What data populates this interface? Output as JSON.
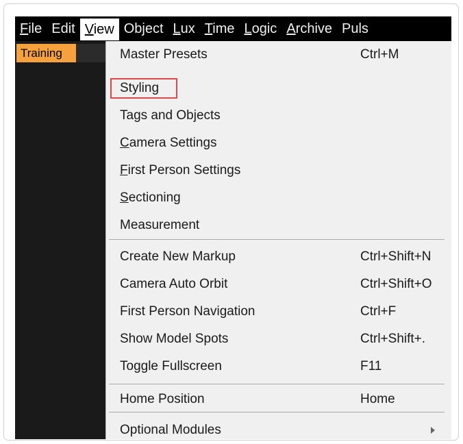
{
  "menubar": {
    "items": [
      {
        "mnemonic": "F",
        "rest": "ile"
      },
      {
        "mnemonic": "",
        "rest": "Edit"
      },
      {
        "mnemonic": "V",
        "rest": "iew"
      },
      {
        "mnemonic": "",
        "rest": "Object"
      },
      {
        "mnemonic": "L",
        "rest": "ux"
      },
      {
        "mnemonic": "T",
        "rest": "ime"
      },
      {
        "mnemonic": "L",
        "rest": "ogic"
      },
      {
        "mnemonic": "A",
        "rest": "rchive"
      },
      {
        "mnemonic": "",
        "rest": "Puls"
      }
    ]
  },
  "sidebar": {
    "badge": "Training"
  },
  "view_menu": {
    "items": [
      {
        "mnemonic": "",
        "rest": "Master Presets",
        "shortcut": "Ctrl+M"
      },
      {
        "mnemonic": "",
        "rest": "Styling",
        "shortcut": ""
      },
      {
        "mnemonic": "",
        "rest": "Tags and Objects",
        "shortcut": ""
      },
      {
        "mnemonic": "C",
        "rest": "amera Settings",
        "shortcut": ""
      },
      {
        "mnemonic": "F",
        "rest": "irst Person Settings",
        "shortcut": ""
      },
      {
        "mnemonic": "S",
        "rest": "ectioning",
        "shortcut": ""
      },
      {
        "mnemonic": "",
        "rest": "Measurement",
        "shortcut": ""
      },
      {
        "mnemonic": "",
        "rest": "Create New Markup",
        "shortcut": "Ctrl+Shift+N"
      },
      {
        "mnemonic": "",
        "rest": "Camera Auto Orbit",
        "shortcut": "Ctrl+Shift+O"
      },
      {
        "mnemonic": "",
        "rest": "First Person Navigation",
        "shortcut": "Ctrl+F"
      },
      {
        "mnemonic": "",
        "rest": "Show Model Spots",
        "shortcut": "Ctrl+Shift+."
      },
      {
        "mnemonic": "",
        "rest": "Toggle Fullscreen",
        "shortcut": "F11"
      },
      {
        "mnemonic": "",
        "rest": "Home Position",
        "shortcut": "Home"
      },
      {
        "mnemonic": "",
        "rest": "Optional Modules",
        "shortcut": ""
      }
    ],
    "highlight_color": "#e0474c",
    "submenu_icon": "chevron-right-icon"
  },
  "colors": {
    "badge": "#f5a13e",
    "menu_bg": "#f0f0f0",
    "menubar_bg": "#000000"
  }
}
